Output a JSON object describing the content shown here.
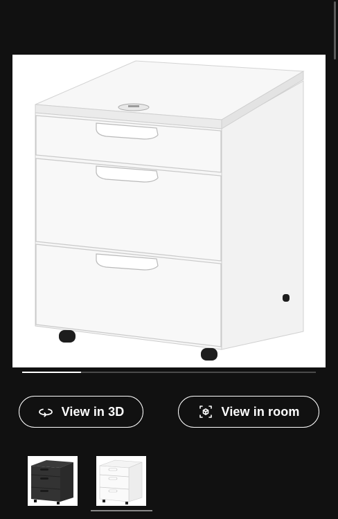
{
  "carousel": {
    "progress": 0.2,
    "main_image": "white-drawer-unit-on-castors"
  },
  "actions": {
    "view_3d_label": "View in 3D",
    "view_3d_icon": "rotate-3d-icon",
    "view_room_label": "View in room",
    "view_room_icon": "ar-room-icon"
  },
  "color_options": [
    {
      "name": "black-brown",
      "selected": false
    },
    {
      "name": "white",
      "selected": true
    }
  ],
  "colors": {
    "background": "#111111",
    "text": "#ffffff",
    "button_border": "#ffffff"
  }
}
